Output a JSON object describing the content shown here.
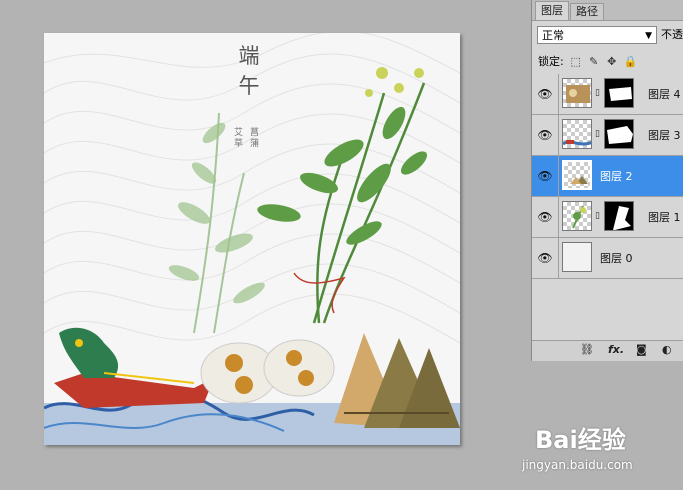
{
  "artwork": {
    "title_chars": [
      "端",
      "午"
    ],
    "sub_col1": "艾草",
    "sub_col2": "菖蒲"
  },
  "layers_panel": {
    "tabs": [
      {
        "label": "图层",
        "active": true
      },
      {
        "label": "路径",
        "active": false
      }
    ],
    "blend_mode": "正常",
    "opacity_label": "不透",
    "lock_label": "锁定:",
    "layers": [
      {
        "name": "图层 4",
        "visible": true,
        "selected": false,
        "has_mask": true
      },
      {
        "name": "图层 3",
        "visible": true,
        "selected": false,
        "has_mask": true
      },
      {
        "name": "图层 2",
        "visible": true,
        "selected": true,
        "has_mask": false
      },
      {
        "name": "图层 1",
        "visible": true,
        "selected": false,
        "has_mask": true
      },
      {
        "name": "图层 0",
        "visible": true,
        "selected": false,
        "has_mask": false
      }
    ],
    "bottom_icons": [
      "link-icon",
      "fx-icon",
      "mask-icon",
      "adjustment-icon"
    ],
    "fx_label": "fx."
  },
  "watermark": {
    "brand": "Bai经验",
    "url": "jingyan.baidu.com"
  },
  "colors": {
    "canvas_bg": "#b3b3b3",
    "panel_bg": "#d6d6d6",
    "selection": "#3d8ee8"
  }
}
